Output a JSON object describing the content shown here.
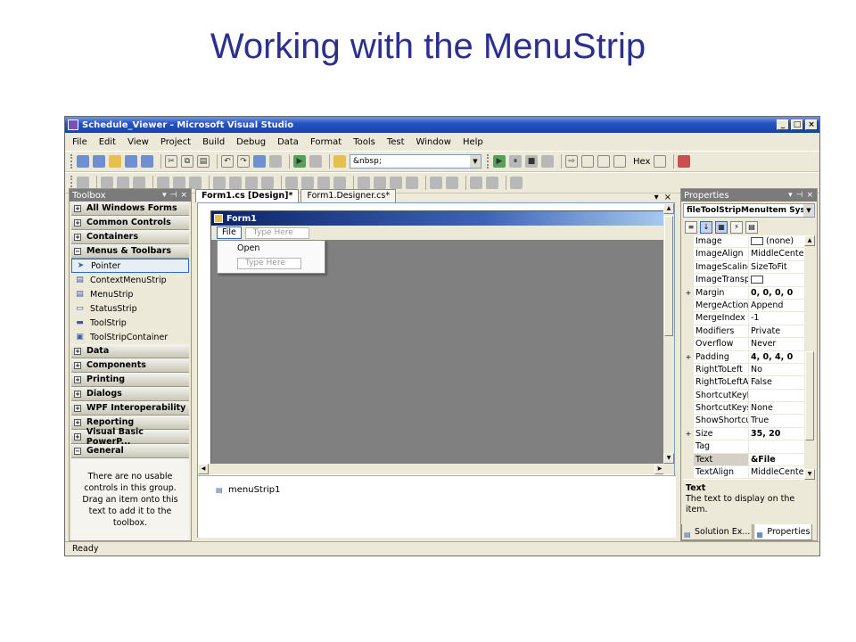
{
  "slide": {
    "title": "Working with the MenuStrip"
  },
  "window": {
    "title": "Schedule_Viewer - Microsoft Visual Studio",
    "min": "_",
    "max": "□",
    "close": "×"
  },
  "menubar": [
    "File",
    "Edit",
    "View",
    "Project",
    "Build",
    "Debug",
    "Data",
    "Format",
    "Tools",
    "Test",
    "Window",
    "Help"
  ],
  "toolbar": {
    "combo_value": "&nbsp;",
    "hex_label": "Hex"
  },
  "toolbox": {
    "title": "Toolbox",
    "categories_top": [
      "All Windows Forms",
      "Common Controls",
      "Containers",
      "Menus & Toolbars"
    ],
    "items": [
      "Pointer",
      "ContextMenuStrip",
      "MenuStrip",
      "StatusStrip",
      "ToolStrip",
      "ToolStripContainer"
    ],
    "categories_bottom": [
      "Data",
      "Components",
      "Printing",
      "Dialogs",
      "WPF Interoperability",
      "Reporting",
      "Visual Basic PowerP...",
      "General"
    ],
    "empty_message": "There are no usable controls in this group. Drag an item onto this text to add it to the toolbox."
  },
  "editor": {
    "tabs": [
      "Form1.cs [Design]*",
      "Form1.Designer.cs*"
    ],
    "form_title": "Form1",
    "menu_file": "File",
    "type_here": "Type Here",
    "dropdown_open": "Open",
    "tray_item": "menuStrip1"
  },
  "properties": {
    "title": "Properties",
    "object": "fileToolStripMenuItem  System.Windows.Forms.ToolStripMenuItem",
    "rows": [
      {
        "name": "Image",
        "value": "(none)",
        "expand": "",
        "swatch": true
      },
      {
        "name": "ImageAlign",
        "value": "MiddleCenter",
        "expand": ""
      },
      {
        "name": "ImageScaling",
        "value": "SizeToFit",
        "expand": ""
      },
      {
        "name": "ImageTransparentColor",
        "value": "",
        "expand": "",
        "swatch": true
      },
      {
        "name": "Margin",
        "value": "0, 0, 0, 0",
        "expand": "+",
        "bold": true
      },
      {
        "name": "MergeAction",
        "value": "Append",
        "expand": ""
      },
      {
        "name": "MergeIndex",
        "value": "-1",
        "expand": ""
      },
      {
        "name": "Modifiers",
        "value": "Private",
        "expand": ""
      },
      {
        "name": "Overflow",
        "value": "Never",
        "expand": ""
      },
      {
        "name": "Padding",
        "value": "4, 0, 4, 0",
        "expand": "+",
        "bold": true
      },
      {
        "name": "RightToLeft",
        "value": "No",
        "expand": ""
      },
      {
        "name": "RightToLeftAutoMirrorImage",
        "value": "False",
        "expand": ""
      },
      {
        "name": "ShortcutKeyDisplayString",
        "value": "",
        "expand": ""
      },
      {
        "name": "ShortcutKeys",
        "value": "None",
        "expand": ""
      },
      {
        "name": "ShowShortcutKeys",
        "value": "True",
        "expand": ""
      },
      {
        "name": "Size",
        "value": "35, 20",
        "expand": "+",
        "bold": true
      },
      {
        "name": "Tag",
        "value": "",
        "expand": ""
      },
      {
        "name": "Text",
        "value": "&File",
        "expand": "",
        "bold": true,
        "selected": true
      },
      {
        "name": "TextAlign",
        "value": "MiddleCenter",
        "expand": ""
      }
    ],
    "desc_title": "Text",
    "desc_text": "The text to display on the item.",
    "tabs": [
      "Solution Ex...",
      "Properties"
    ]
  },
  "status": "Ready"
}
